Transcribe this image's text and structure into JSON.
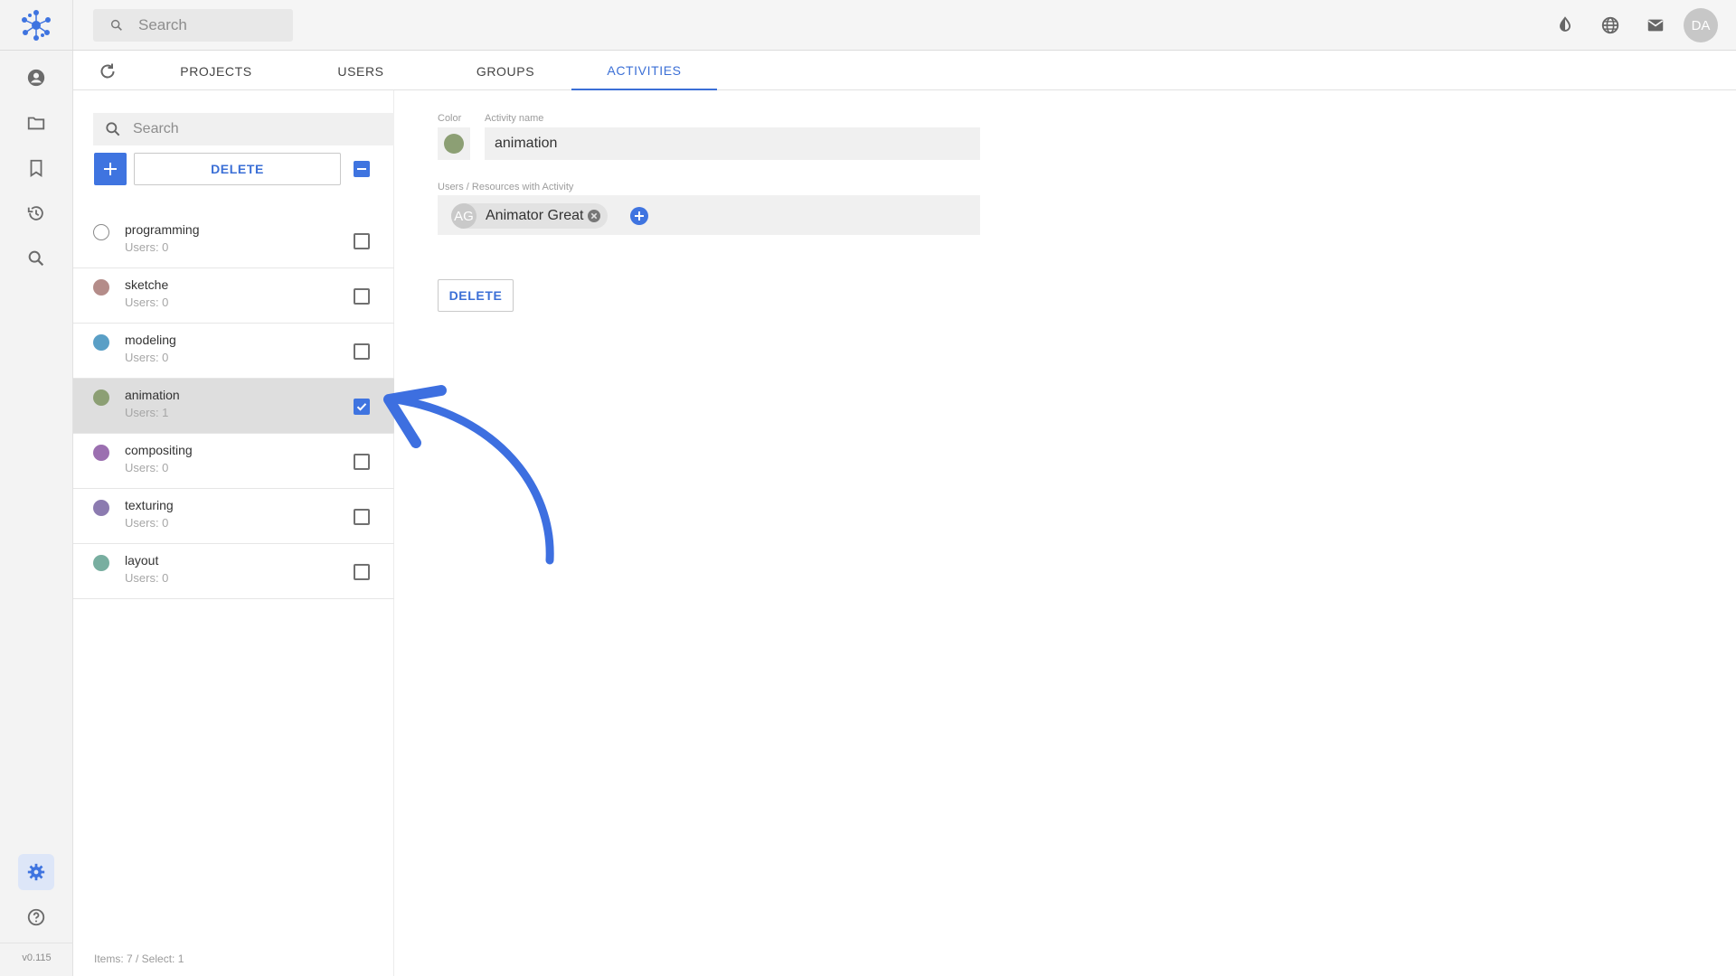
{
  "header": {
    "search_placeholder": "Search",
    "avatar_initials": "DA"
  },
  "rail": {
    "version": "v0.115"
  },
  "tabs": [
    {
      "label": "PROJECTS",
      "active": false
    },
    {
      "label": "USERS",
      "active": false
    },
    {
      "label": "GROUPS",
      "active": false
    },
    {
      "label": "ACTIVITIES",
      "active": true
    }
  ],
  "list": {
    "search_placeholder": "Search",
    "delete_label": "DELETE",
    "items": [
      {
        "name": "programming",
        "users": "Users: 0",
        "color": "#ffffff",
        "checked": false
      },
      {
        "name": "sketche",
        "users": "Users: 0",
        "color": "#b48c89",
        "checked": false
      },
      {
        "name": "modeling",
        "users": "Users: 0",
        "color": "#5a9fc6",
        "checked": false
      },
      {
        "name": "animation",
        "users": "Users: 1",
        "color": "#8c9f74",
        "checked": true
      },
      {
        "name": "compositing",
        "users": "Users: 0",
        "color": "#9b6fb0",
        "checked": false
      },
      {
        "name": "texturing",
        "users": "Users: 0",
        "color": "#8c7bb0",
        "checked": false
      },
      {
        "name": "layout",
        "users": "Users: 0",
        "color": "#78aea0",
        "checked": false
      }
    ],
    "footer": "Items: 7 / Select: 1"
  },
  "detail": {
    "color_label": "Color",
    "color_value": "#8c9f74",
    "name_label": "Activity name",
    "name_value": "animation",
    "users_label": "Users / Resources with Activity",
    "user_chip": {
      "initials": "AG",
      "name": "Animator Great"
    },
    "delete_label": "DELETE"
  },
  "colors": {
    "accent": "#3f74e0",
    "arrow": "#3d6fe0"
  }
}
